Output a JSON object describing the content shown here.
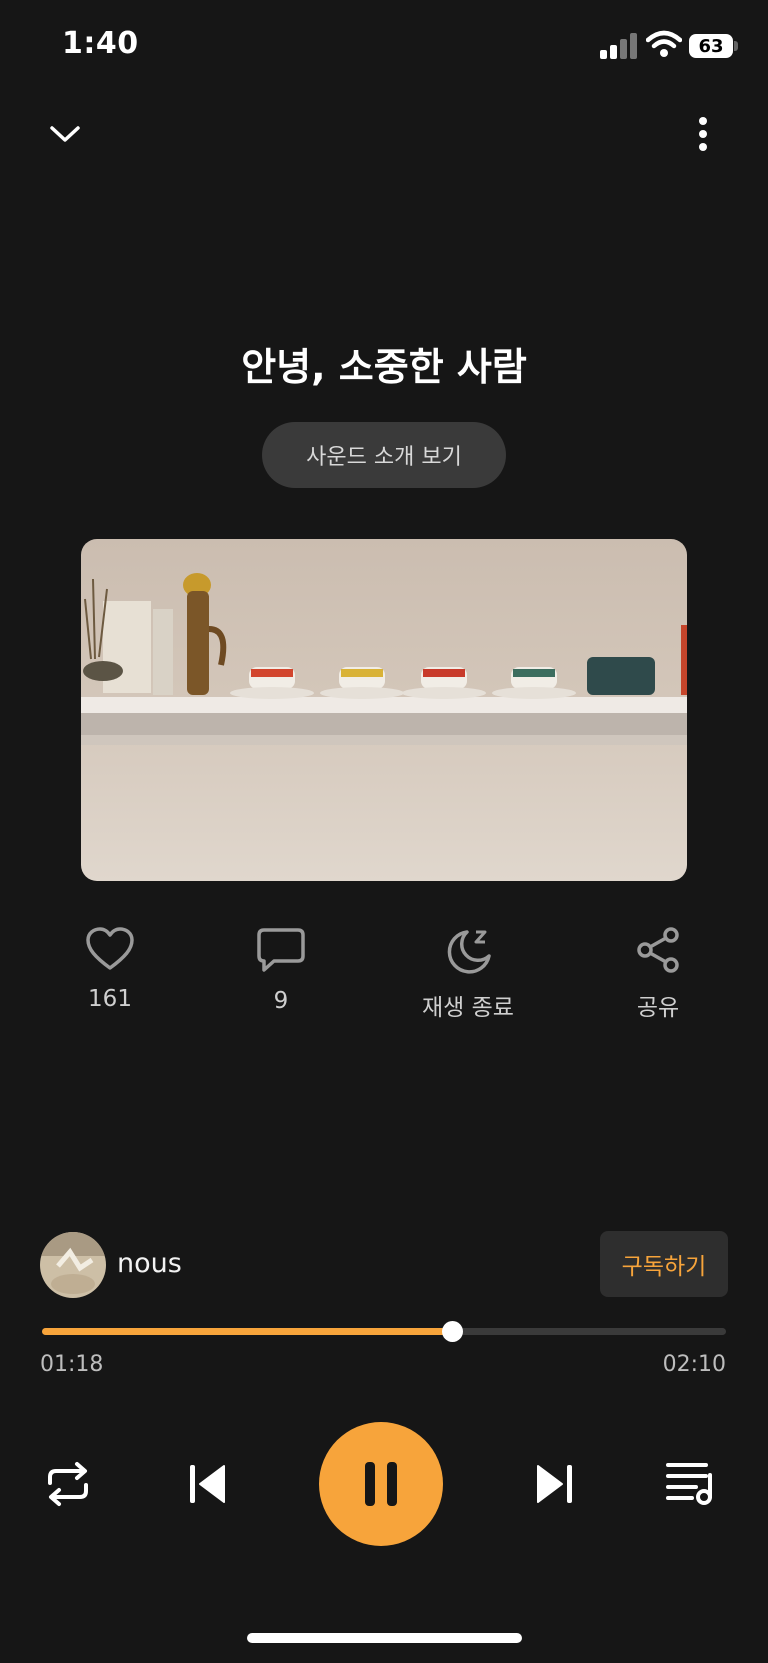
{
  "status_bar": {
    "time": "1:40",
    "battery": "63"
  },
  "header": {
    "collapse_icon": "chevron-down-icon",
    "more_icon": "more-vertical-icon"
  },
  "track": {
    "title": "안녕, 소중한 사람",
    "intro_button": "사운드 소개 보기"
  },
  "actions": [
    {
      "icon": "heart-icon",
      "label": "161"
    },
    {
      "icon": "comment-icon",
      "label": "9"
    },
    {
      "icon": "sleep-timer-icon",
      "label": "재생 종료"
    },
    {
      "icon": "share-icon",
      "label": "공유"
    }
  ],
  "author": {
    "name": "nous",
    "subscribe_label": "구독하기"
  },
  "progress": {
    "current": "01:18",
    "total": "02:10",
    "fraction": 0.6
  },
  "controls": {
    "repeat": "repeat-icon",
    "previous": "skip-back-icon",
    "play_pause": "pause-icon",
    "next": "skip-forward-icon",
    "playlist": "playlist-icon"
  },
  "colors": {
    "accent": "#F7A43B",
    "background": "#161616"
  }
}
